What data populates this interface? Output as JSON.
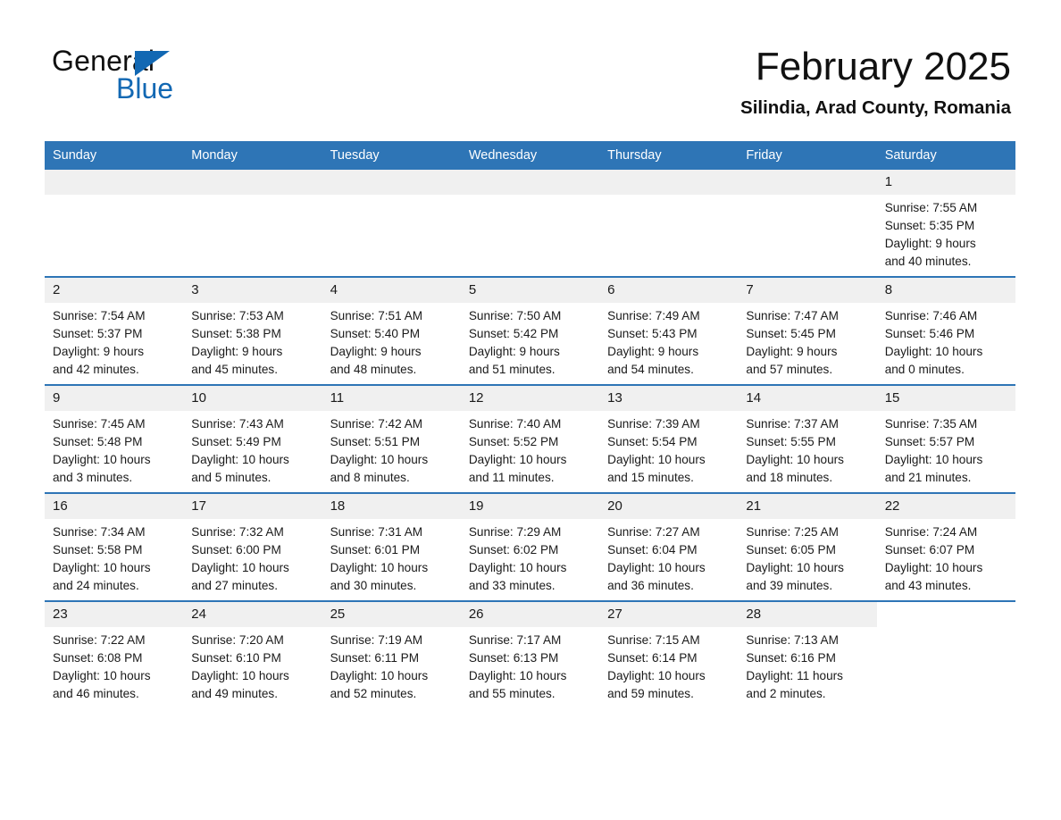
{
  "logo": {
    "word_one": "General",
    "word_two": "Blue",
    "flag_icon": "triangle-flag-icon",
    "brand_color": "#1268b3"
  },
  "header": {
    "month_title": "February 2025",
    "location": "Silindia, Arad County, Romania"
  },
  "theme": {
    "header_blue": "#2e75b6",
    "daynum_band": "#f0f0f0",
    "row_divider": "#2e75b6",
    "text": "#1a1a1a"
  },
  "weekday_headers": [
    "Sunday",
    "Monday",
    "Tuesday",
    "Wednesday",
    "Thursday",
    "Friday",
    "Saturday"
  ],
  "weeks": [
    [
      {
        "day": "",
        "lines": []
      },
      {
        "day": "",
        "lines": []
      },
      {
        "day": "",
        "lines": []
      },
      {
        "day": "",
        "lines": []
      },
      {
        "day": "",
        "lines": []
      },
      {
        "day": "",
        "lines": []
      },
      {
        "day": "1",
        "lines": [
          "Sunrise: 7:55 AM",
          "Sunset: 5:35 PM",
          "Daylight: 9 hours",
          "and 40 minutes."
        ]
      }
    ],
    [
      {
        "day": "2",
        "lines": [
          "Sunrise: 7:54 AM",
          "Sunset: 5:37 PM",
          "Daylight: 9 hours",
          "and 42 minutes."
        ]
      },
      {
        "day": "3",
        "lines": [
          "Sunrise: 7:53 AM",
          "Sunset: 5:38 PM",
          "Daylight: 9 hours",
          "and 45 minutes."
        ]
      },
      {
        "day": "4",
        "lines": [
          "Sunrise: 7:51 AM",
          "Sunset: 5:40 PM",
          "Daylight: 9 hours",
          "and 48 minutes."
        ]
      },
      {
        "day": "5",
        "lines": [
          "Sunrise: 7:50 AM",
          "Sunset: 5:42 PM",
          "Daylight: 9 hours",
          "and 51 minutes."
        ]
      },
      {
        "day": "6",
        "lines": [
          "Sunrise: 7:49 AM",
          "Sunset: 5:43 PM",
          "Daylight: 9 hours",
          "and 54 minutes."
        ]
      },
      {
        "day": "7",
        "lines": [
          "Sunrise: 7:47 AM",
          "Sunset: 5:45 PM",
          "Daylight: 9 hours",
          "and 57 minutes."
        ]
      },
      {
        "day": "8",
        "lines": [
          "Sunrise: 7:46 AM",
          "Sunset: 5:46 PM",
          "Daylight: 10 hours",
          "and 0 minutes."
        ]
      }
    ],
    [
      {
        "day": "9",
        "lines": [
          "Sunrise: 7:45 AM",
          "Sunset: 5:48 PM",
          "Daylight: 10 hours",
          "and 3 minutes."
        ]
      },
      {
        "day": "10",
        "lines": [
          "Sunrise: 7:43 AM",
          "Sunset: 5:49 PM",
          "Daylight: 10 hours",
          "and 5 minutes."
        ]
      },
      {
        "day": "11",
        "lines": [
          "Sunrise: 7:42 AM",
          "Sunset: 5:51 PM",
          "Daylight: 10 hours",
          "and 8 minutes."
        ]
      },
      {
        "day": "12",
        "lines": [
          "Sunrise: 7:40 AM",
          "Sunset: 5:52 PM",
          "Daylight: 10 hours",
          "and 11 minutes."
        ]
      },
      {
        "day": "13",
        "lines": [
          "Sunrise: 7:39 AM",
          "Sunset: 5:54 PM",
          "Daylight: 10 hours",
          "and 15 minutes."
        ]
      },
      {
        "day": "14",
        "lines": [
          "Sunrise: 7:37 AM",
          "Sunset: 5:55 PM",
          "Daylight: 10 hours",
          "and 18 minutes."
        ]
      },
      {
        "day": "15",
        "lines": [
          "Sunrise: 7:35 AM",
          "Sunset: 5:57 PM",
          "Daylight: 10 hours",
          "and 21 minutes."
        ]
      }
    ],
    [
      {
        "day": "16",
        "lines": [
          "Sunrise: 7:34 AM",
          "Sunset: 5:58 PM",
          "Daylight: 10 hours",
          "and 24 minutes."
        ]
      },
      {
        "day": "17",
        "lines": [
          "Sunrise: 7:32 AM",
          "Sunset: 6:00 PM",
          "Daylight: 10 hours",
          "and 27 minutes."
        ]
      },
      {
        "day": "18",
        "lines": [
          "Sunrise: 7:31 AM",
          "Sunset: 6:01 PM",
          "Daylight: 10 hours",
          "and 30 minutes."
        ]
      },
      {
        "day": "19",
        "lines": [
          "Sunrise: 7:29 AM",
          "Sunset: 6:02 PM",
          "Daylight: 10 hours",
          "and 33 minutes."
        ]
      },
      {
        "day": "20",
        "lines": [
          "Sunrise: 7:27 AM",
          "Sunset: 6:04 PM",
          "Daylight: 10 hours",
          "and 36 minutes."
        ]
      },
      {
        "day": "21",
        "lines": [
          "Sunrise: 7:25 AM",
          "Sunset: 6:05 PM",
          "Daylight: 10 hours",
          "and 39 minutes."
        ]
      },
      {
        "day": "22",
        "lines": [
          "Sunrise: 7:24 AM",
          "Sunset: 6:07 PM",
          "Daylight: 10 hours",
          "and 43 minutes."
        ]
      }
    ],
    [
      {
        "day": "23",
        "lines": [
          "Sunrise: 7:22 AM",
          "Sunset: 6:08 PM",
          "Daylight: 10 hours",
          "and 46 minutes."
        ]
      },
      {
        "day": "24",
        "lines": [
          "Sunrise: 7:20 AM",
          "Sunset: 6:10 PM",
          "Daylight: 10 hours",
          "and 49 minutes."
        ]
      },
      {
        "day": "25",
        "lines": [
          "Sunrise: 7:19 AM",
          "Sunset: 6:11 PM",
          "Daylight: 10 hours",
          "and 52 minutes."
        ]
      },
      {
        "day": "26",
        "lines": [
          "Sunrise: 7:17 AM",
          "Sunset: 6:13 PM",
          "Daylight: 10 hours",
          "and 55 minutes."
        ]
      },
      {
        "day": "27",
        "lines": [
          "Sunrise: 7:15 AM",
          "Sunset: 6:14 PM",
          "Daylight: 10 hours",
          "and 59 minutes."
        ]
      },
      {
        "day": "28",
        "lines": [
          "Sunrise: 7:13 AM",
          "Sunset: 6:16 PM",
          "Daylight: 11 hours",
          "and 2 minutes."
        ]
      },
      {
        "day": "",
        "lines": []
      }
    ]
  ]
}
